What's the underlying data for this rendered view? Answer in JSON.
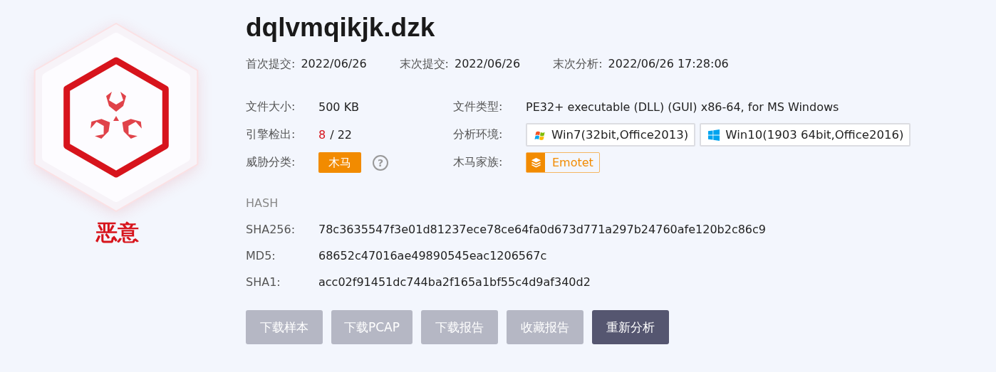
{
  "verdict": {
    "label": "恶意"
  },
  "file_name": "dqlvmqikjk.dzk",
  "meta": [
    {
      "label": "首次提交:",
      "value": "2022/06/26"
    },
    {
      "label": "末次提交:",
      "value": "2022/06/26"
    },
    {
      "label": "末次分析:",
      "value": "2022/06/26 17:28:06"
    }
  ],
  "file_size": {
    "label": "文件大小:",
    "value": "500 KB"
  },
  "file_type": {
    "label": "文件类型:",
    "value": "PE32+ executable (DLL) (GUI) x86-64, for MS Windows"
  },
  "engine_detection": {
    "label": "引擎检出:",
    "detected": "8",
    "total": "/ 22"
  },
  "environments": {
    "label": "分析环境:",
    "items": [
      {
        "kind": "win7",
        "label": "Win7(32bit,Office2013)"
      },
      {
        "kind": "win10",
        "label": "Win10(1903 64bit,Office2016)"
      }
    ]
  },
  "threat_class": {
    "label": "威胁分类:",
    "tag": "木马",
    "help": "?"
  },
  "family": {
    "label": "木马家族:",
    "tag": "Emotet"
  },
  "hash": {
    "heading": "HASH",
    "rows": [
      {
        "label": "SHA256:",
        "value": "78c3635547f3e01d81237ece78ce64fa0d673d771a297b24760afe120b2c86c9"
      },
      {
        "label": "MD5:",
        "value": "68652c47016ae49890545eac1206567c"
      },
      {
        "label": "SHA1:",
        "value": "acc02f91451dc744ba2f165a1bf55c4d9af340d2"
      }
    ]
  },
  "buttons": [
    {
      "label": "下载样本",
      "disabled": true
    },
    {
      "label": "下载PCAP",
      "disabled": true
    },
    {
      "label": "下载报告",
      "disabled": true
    },
    {
      "label": "收藏报告",
      "disabled": true
    },
    {
      "label": "重新分析",
      "disabled": false
    }
  ]
}
